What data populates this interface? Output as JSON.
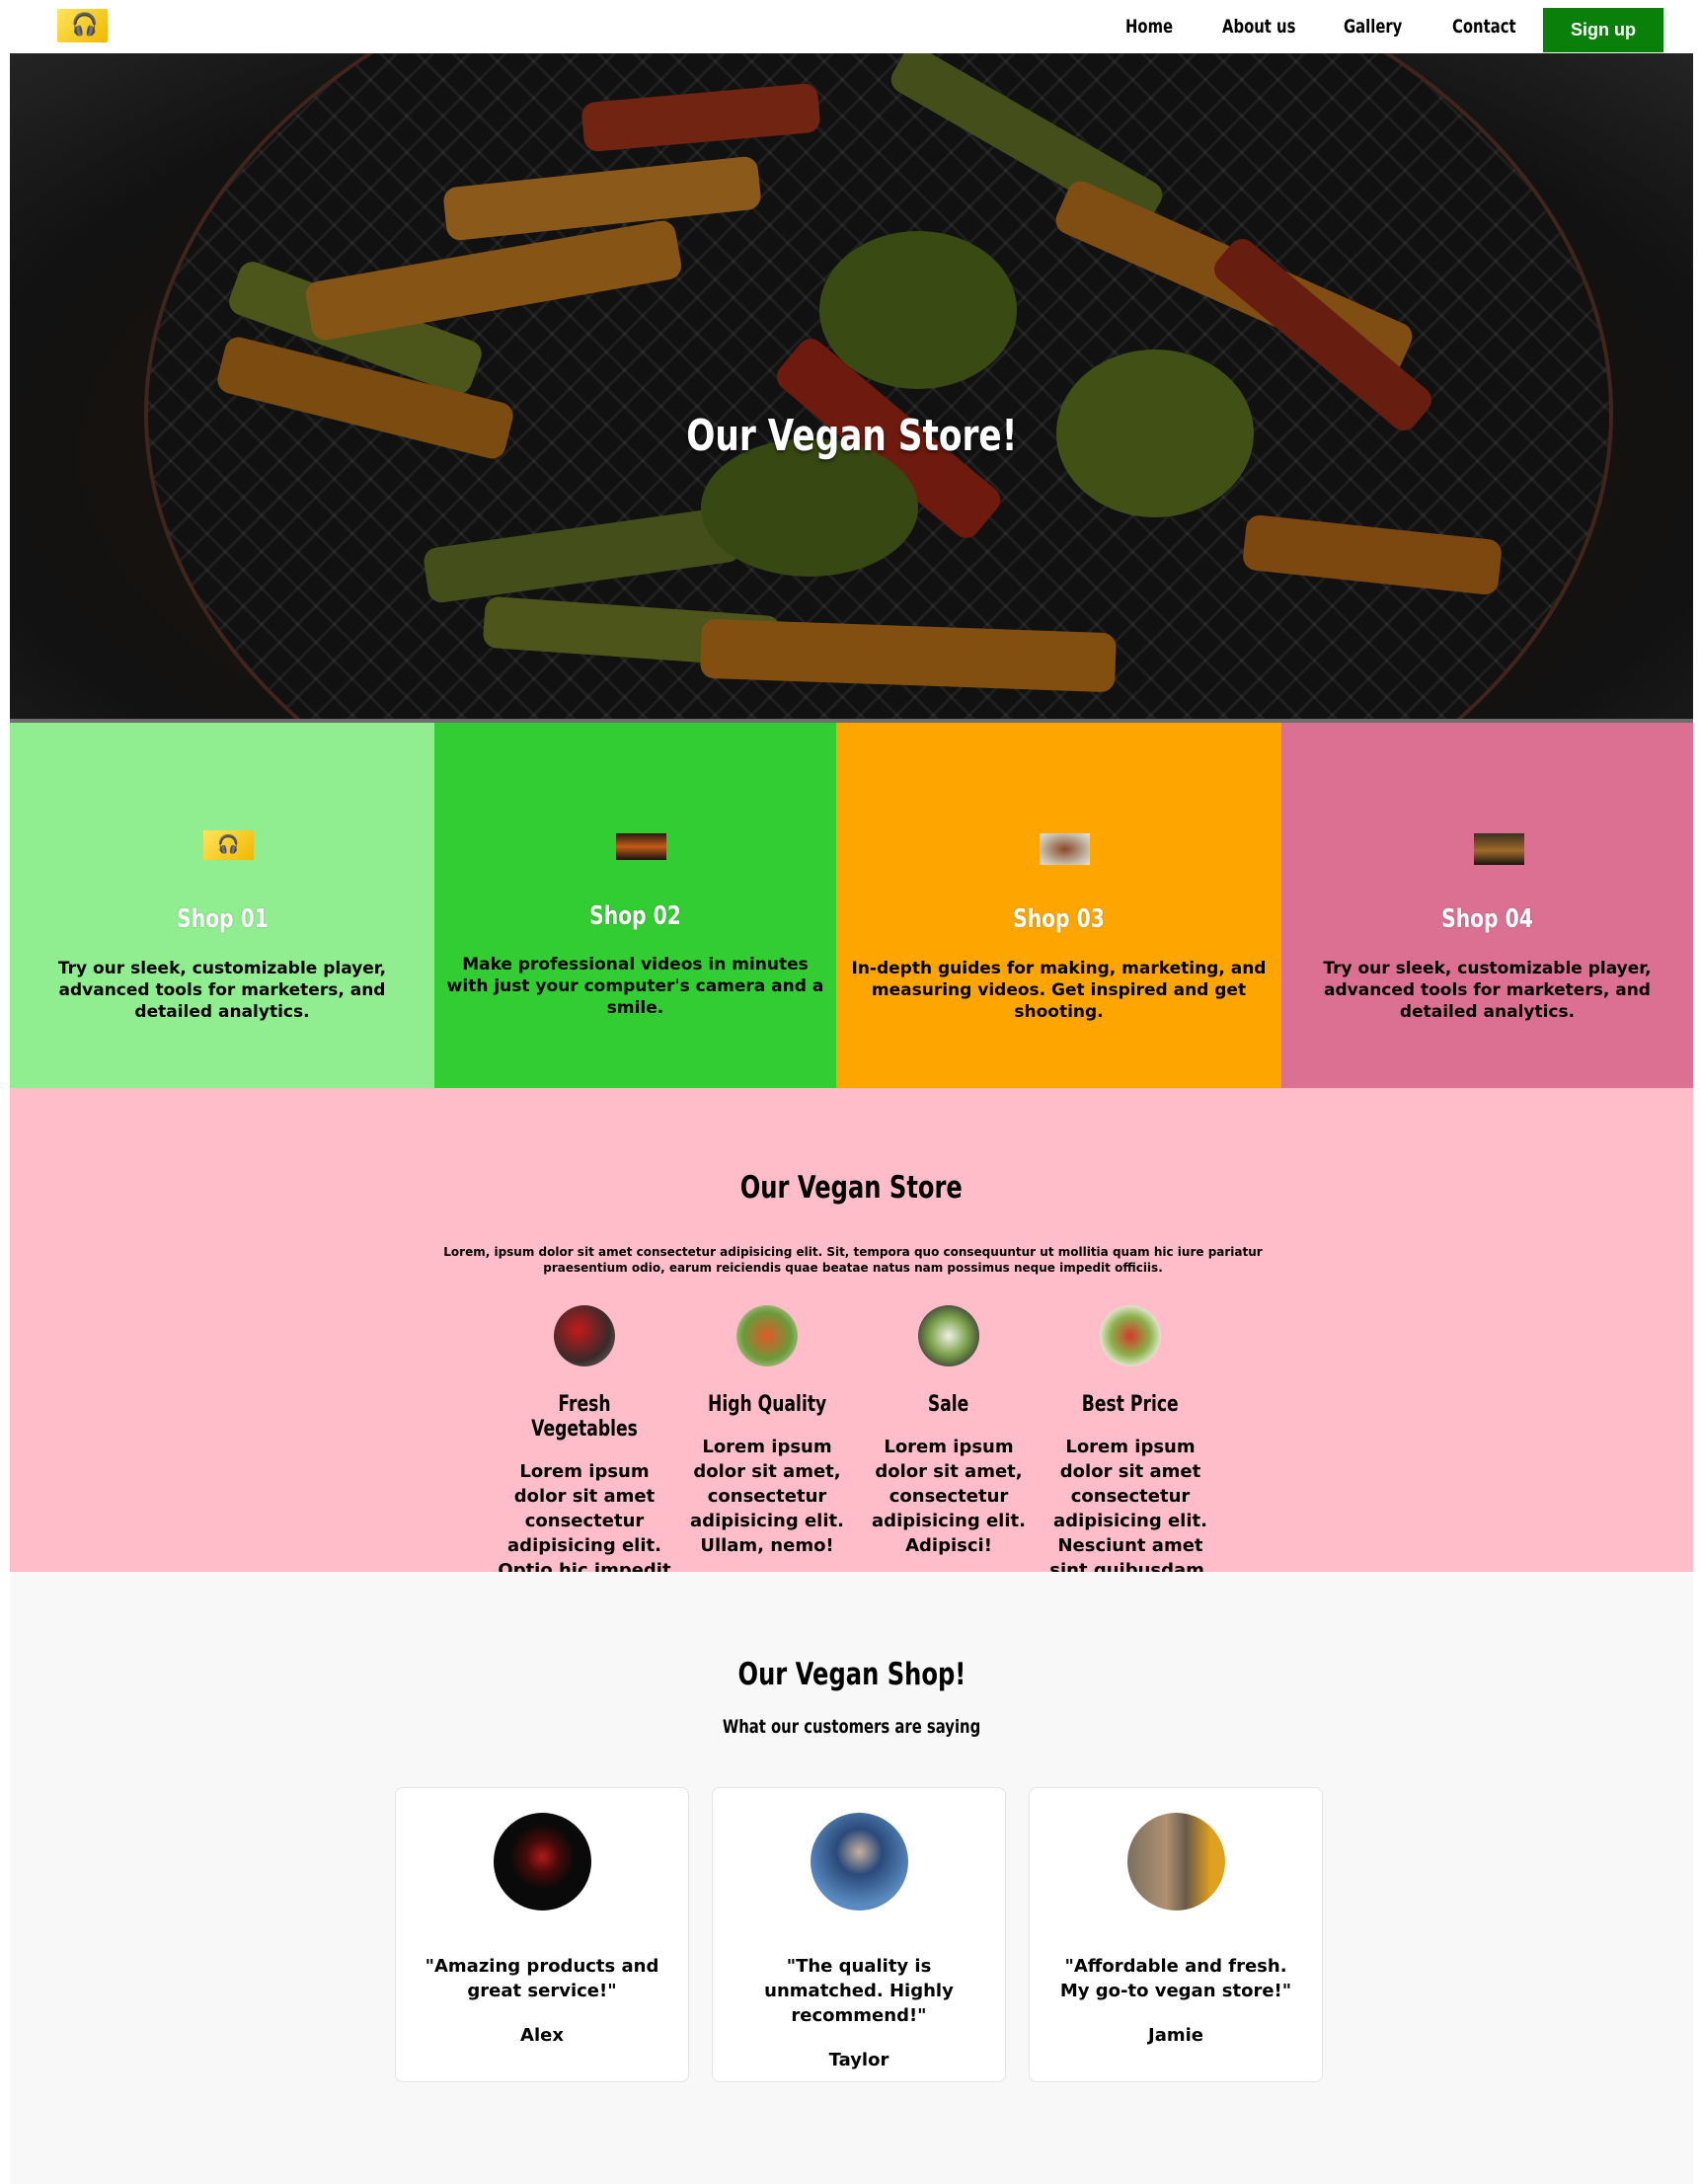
{
  "nav": {
    "logo_icon": "headphones-logo",
    "links": [
      "Home",
      "About us",
      "Gallery",
      "Contact"
    ],
    "signup_label": "Sign up",
    "signup_color": "#0a7f0a"
  },
  "hero": {
    "title": "Our Vegan Store!"
  },
  "shops": [
    {
      "title": "Shop 01",
      "text": "Try our sleek, customizable player, advanced tools for marketers, and detailed analytics.",
      "color": "#90ee90"
    },
    {
      "title": "Shop 02",
      "text": "Make professional videos in minutes with just your computer's camera and a smile.",
      "color": "#32cd32"
    },
    {
      "title": "Shop 03",
      "text": "In-depth guides for making, marketing, and measuring videos. Get inspired and get shooting.",
      "color": "#ffa500"
    },
    {
      "title": "Shop 04",
      "text": "Try our sleek, customizable player, advanced tools for marketers, and detailed analytics.",
      "color": "#db7093"
    }
  ],
  "features": {
    "title": "Our Vegan Store",
    "lead": "Lorem, ipsum dolor sit amet consectetur adipisicing elit. Sit, tempora quo consequuntur ut mollitia quam hic iure pariatur praesentium odio, earum reiciendis quae beatae natus nam possimus neque impedit officiis.",
    "items": [
      {
        "name": "Fresh Vegetables",
        "desc": "Lorem ipsum dolor sit amet consectetur adipisicing elit. Optio hic impedit eius veritatis minima."
      },
      {
        "name": "High Quality",
        "desc": "Lorem ipsum dolor sit amet, consectetur adipisicing elit. Ullam, nemo!"
      },
      {
        "name": "Sale",
        "desc": "Lorem ipsum dolor sit amet, consectetur adipisicing elit. Adipisci!"
      },
      {
        "name": "Best Price",
        "desc": "Lorem ipsum dolor sit amet consectetur adipisicing elit. Nesciunt amet sint quibusdam."
      }
    ],
    "background": "#ffbdca"
  },
  "testimonials": {
    "title": "Our Vegan Shop!",
    "subtitle": "What our customers are saying",
    "cards": [
      {
        "quote": "\"Amazing products and great service!\"",
        "author": "Alex"
      },
      {
        "quote": "\"The quality is unmatched. Highly recommend!\"",
        "author": "Taylor"
      },
      {
        "quote": "\"Affordable and fresh. My go-to vegan store!\"",
        "author": "Jamie"
      }
    ]
  }
}
